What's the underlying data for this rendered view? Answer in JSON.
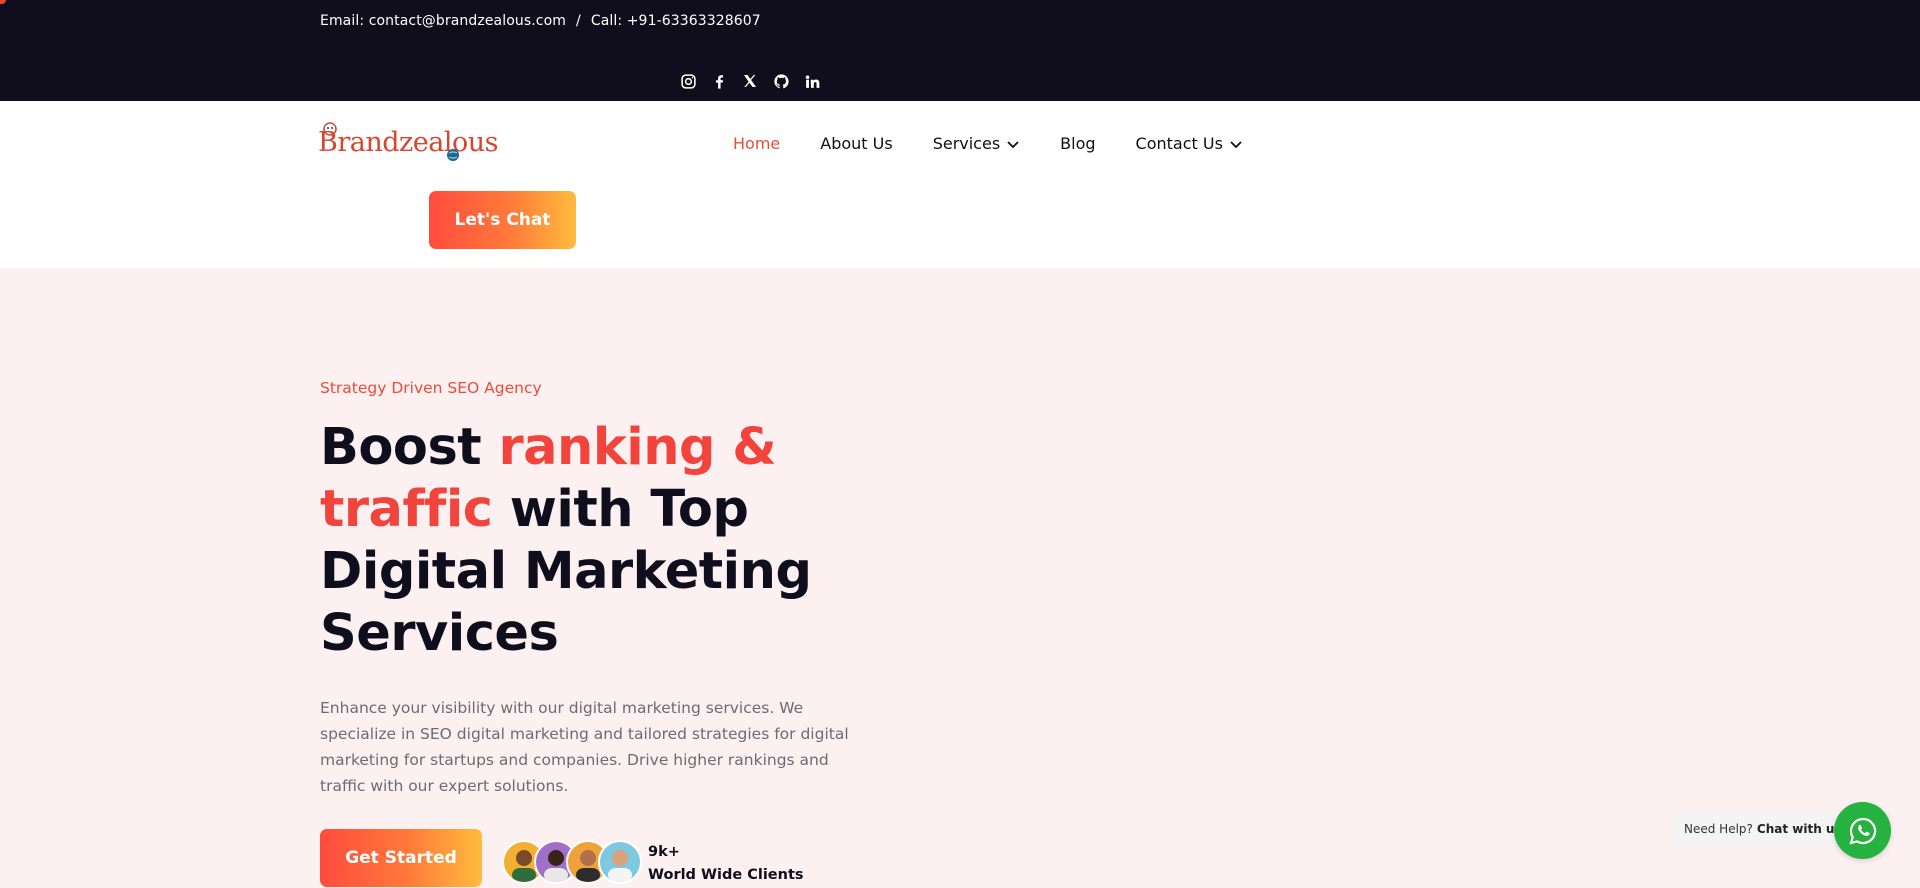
{
  "topbar": {
    "email": "Email: contact@brandzealous.com",
    "separator": "/",
    "phone": "Call: +91-63363328607",
    "socials": [
      "instagram-icon",
      "facebook-icon",
      "x-twitter-icon",
      "github-icon",
      "linkedin-icon"
    ]
  },
  "header": {
    "logo_text": "Brandzealous",
    "nav": [
      {
        "label": "Home",
        "active": true
      },
      {
        "label": "About Us"
      },
      {
        "label": "Services",
        "dropdown": true
      },
      {
        "label": "Blog"
      },
      {
        "label": "Contact Us",
        "dropdown": true
      }
    ],
    "cta_label": "Let's Chat"
  },
  "hero": {
    "eyebrow": "Strategy Driven SEO Agency",
    "headline": {
      "part1": "Boost ",
      "accent": "ranking & traffic",
      "part2": " with Top Digital Marketing Services"
    },
    "description": "Enhance your visibility with our digital marketing services. We specialize in SEO digital marketing and tailored strategies for digital marketing for startups and companies. Drive higher rankings and traffic with our expert solutions.",
    "button_label": "Get Started",
    "clients_count": "9k+",
    "clients_label": "World Wide Clients"
  },
  "help": {
    "prefix": "Need Help?",
    "link": "Chat with us"
  },
  "colors": {
    "accent": "#f0443c",
    "dark": "#100e1d",
    "hero_bg": "#fdf0f0",
    "whatsapp": "#25b240"
  }
}
